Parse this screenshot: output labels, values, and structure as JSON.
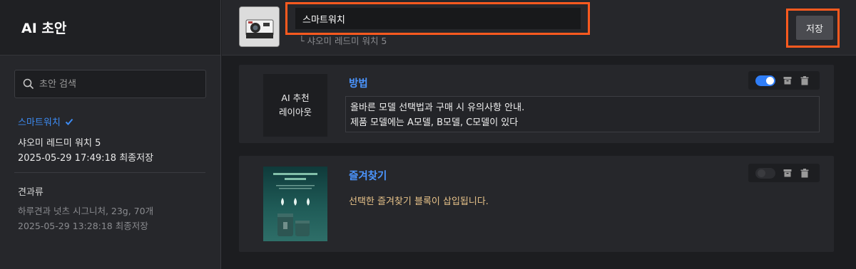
{
  "sidebar": {
    "title": "AI 초안",
    "search_placeholder": "초안 검색",
    "active_draft": {
      "title": "스마트워치",
      "product": "샤오미 레드미 워치 5",
      "saved": "2025-05-29 17:49:18 최종저장"
    },
    "other_draft": {
      "title": "견과류",
      "product": "하루견과 넛츠 시그니처, 23g, 70개",
      "saved": "2025-05-29 13:28:18 최종저장"
    }
  },
  "header": {
    "name_value": "스마트워치",
    "product_sub": "└ 샤오미 레드미 워치 5",
    "save_label": "저장"
  },
  "blocks": [
    {
      "thumb_line1": "AI 추천",
      "thumb_line2": "레이아웃",
      "title": "방법",
      "body_line1": "올바른 모델 선택법과 구매 시 유의사항 안내.",
      "body_line2": "제품 모델에는 A모델, B모델, C모델이 있다",
      "enabled": true
    },
    {
      "title": "즐겨찾기",
      "note": "선택한 즐겨찾기 블록이 삽입됩니다.",
      "enabled": false
    }
  ],
  "colors": {
    "accent": "#3d8bf2",
    "highlight": "#ff5a1f",
    "note": "#e8c38a"
  }
}
